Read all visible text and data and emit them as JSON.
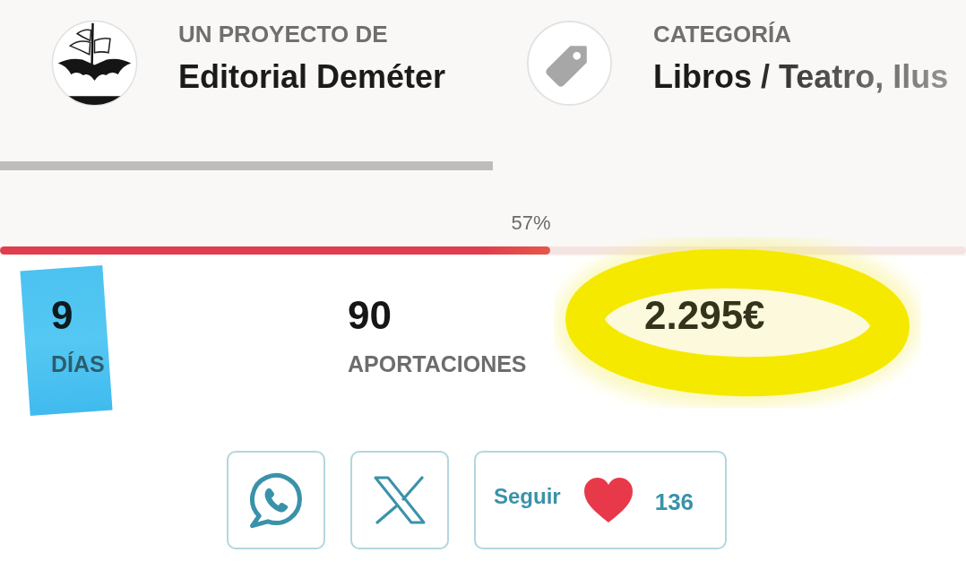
{
  "header": [
    {
      "kind": "publisher",
      "label": "UN PROYECTO DE",
      "value": "Editorial Deméter"
    },
    {
      "kind": "category",
      "label": "CATEGORÍA",
      "value": "Libros / Teatro, Ilus"
    }
  ],
  "progress": {
    "label": "57%",
    "level": 0.57
  },
  "stats": [
    {
      "kind": "highlighted",
      "value": "9",
      "label": "DÍAS"
    },
    {
      "kind": "plain",
      "value": "90",
      "label": "APORTACIONES"
    },
    {
      "kind": "circled",
      "value": "2.295€"
    }
  ],
  "share_buttons": [
    {
      "kind": "whatsapp"
    },
    {
      "kind": "x"
    }
  ],
  "follow": {
    "label": "Seguir",
    "count": "136"
  }
}
